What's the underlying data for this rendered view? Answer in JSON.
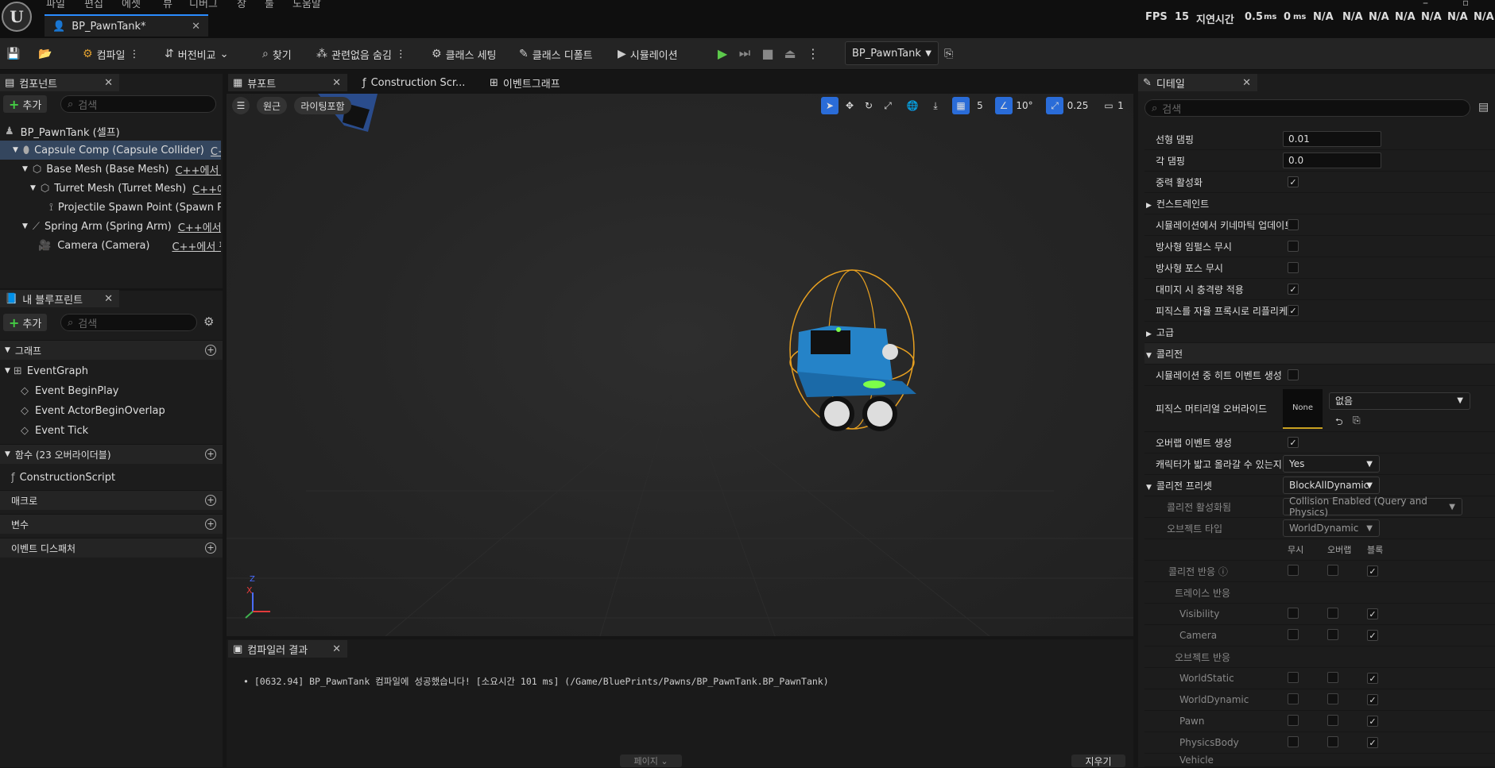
{
  "menu": [
    "파일",
    "편집",
    "에셋",
    "뷰",
    "디버그",
    "창",
    "툴",
    "도움말"
  ],
  "doc_tab": {
    "title": "BP_PawnTank*"
  },
  "stats": {
    "fps_label": "FPS",
    "fps_value": "15",
    "latency_label": "지연시간",
    "latency_a": "0.5",
    "latency_b": "0",
    "ms": "ms",
    "na": "N/A"
  },
  "toolbar": {
    "compile": "컴파일",
    "diff": "버전비교",
    "find": "찾기",
    "hide_unrelated": "관련없음 숨김",
    "class_settings": "클래스 세팅",
    "class_defaults": "클래스 디폴트",
    "simulation": "시뮬레이션",
    "debug_object": "BP_PawnTank"
  },
  "components_panel": {
    "title": "컴포넌트",
    "add": "추가",
    "search_placeholder": "검색",
    "items": [
      {
        "label": "BP_PawnTank (셀프)",
        "cpp": ""
      },
      {
        "label": "Capsule Comp (Capsule Collider)",
        "cpp": "C++에서 편집"
      },
      {
        "label": "Base Mesh (Base Mesh)",
        "cpp": "C++에서 편집"
      },
      {
        "label": "Turret Mesh (Turret Mesh)",
        "cpp": "C++에서 편집"
      },
      {
        "label": "Projectile Spawn Point (Spawn Point)",
        "cpp": ""
      },
      {
        "label": "Spring Arm (Spring Arm)",
        "cpp": "C++에서 편집"
      },
      {
        "label": "Camera (Camera)",
        "cpp": "C++에서 편집"
      }
    ]
  },
  "blueprint_panel": {
    "title": "내 블루프린트",
    "add": "추가",
    "search_placeholder": "검색",
    "graph_section": "그래프",
    "event_graph": "EventGraph",
    "events": [
      "Event BeginPlay",
      "Event ActorBeginOverlap",
      "Event Tick"
    ],
    "functions_section": "함수 (23 오버라이더블)",
    "construction_script": "ConstructionScript",
    "macros": "매크로",
    "variables": "변수",
    "dispatchers": "이벤트 디스패처"
  },
  "center_tabs": {
    "viewport": "뷰포트",
    "construction": "Construction Scr...",
    "event_graph": "이벤트그래프"
  },
  "viewport": {
    "perspective": "원근",
    "lit": "라이팅포함",
    "grid": "5",
    "angle": "10°",
    "scale": "0.25",
    "speed": "1",
    "axis_x": "X",
    "axis_z": "Z"
  },
  "compiler": {
    "title": "컴파일러 결과",
    "message": "[0632.94] BP_PawnTank 컴파일에 성공했습니다! [소요시간 101 ms] (/Game/BluePrints/Pawns/BP_PawnTank.BP_PawnTank)",
    "pages": "페이지",
    "clear": "지우기"
  },
  "details": {
    "title": "디테일",
    "search_placeholder": "검색",
    "linear_damping_label": "선형 댐핑",
    "linear_damping": "0.01",
    "angular_damping_label": "각 댐핑",
    "angular_damping": "0.0",
    "gravity": "중력 활성화",
    "constraints": "컨스트레인트",
    "kinematic": "시뮬레이션에서 키네마틱 업데이트",
    "ignore_impulse": "방사형 임펄스 무시",
    "ignore_force": "방사형 포스 무시",
    "damage_impulse": "대미지 시 충격량 적용",
    "replicate_physics": "피직스를 자율 프록시로 리플리케...",
    "advanced": "고급",
    "collision_section": "콜리전",
    "hit_events": "시뮬레이션 중 히트 이벤트 생성",
    "phys_material": "피직스 머티리얼 오버라이드",
    "phys_material_thumb": "None",
    "phys_material_value": "없음",
    "overlap_events": "오버랩 이벤트 생성",
    "can_step_up": "캐릭터가 밟고 올라갈 수 있는지...",
    "can_step_up_value": "Yes",
    "preset": "콜리전 프리셋",
    "preset_value": "BlockAllDynamic",
    "collision_enabled": "콜리전 활성화됨",
    "collision_enabled_value": "Collision Enabled (Query and Physics)",
    "object_type": "오브젝트 타입",
    "object_type_value": "WorldDynamic",
    "col_ignore": "무시",
    "col_overlap": "오버랩",
    "col_block": "블록",
    "collision_response": "콜리전 반응",
    "trace_response": "트레이스 반응",
    "visibility": "Visibility",
    "camera": "Camera",
    "object_response": "오브젝트 반응",
    "world_static": "WorldStatic",
    "world_dynamic": "WorldDynamic",
    "pawn": "Pawn",
    "physics_body": "PhysicsBody",
    "vehicle": "Vehicle"
  }
}
